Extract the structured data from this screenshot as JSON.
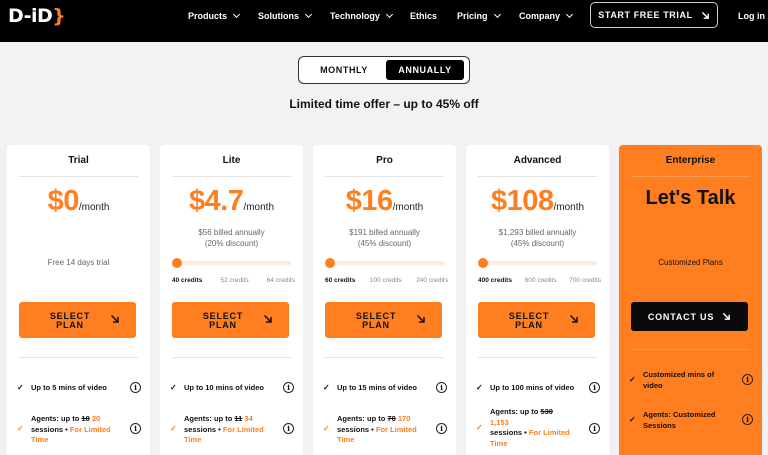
{
  "nav": {
    "logo": "D-iD",
    "items": [
      "Products",
      "Solutions",
      "Technology",
      "Ethics",
      "Pricing",
      "Company"
    ],
    "cta": "START FREE TRIAL",
    "login": "Log in"
  },
  "billing_toggle": {
    "monthly": "MONTHLY",
    "annually": "ANNUALLY",
    "selected": "ANNUALLY"
  },
  "offer": "Limited time offer – up to 45% off",
  "colors": {
    "accent": "#ff7e1f",
    "nav_bg": "#000000",
    "page_bg": "#f2f2f2"
  },
  "plans": {
    "trial": {
      "name": "Trial",
      "price": "$0",
      "period": "/month",
      "note": "Free 14 days trial",
      "button": [
        "SELECT",
        "PLAN"
      ],
      "f1": "Up to 5 mins of video",
      "f2_pre": "Agents: up to ",
      "f2_old": "10",
      "f2_new": " 20",
      "f2_sess": "sessions • ",
      "f2_limited": "For Limited Time"
    },
    "lite": {
      "name": "Lite",
      "price": "$4.7",
      "period": "/month",
      "billed": "$56 billed annually",
      "discount": "(20% discount)",
      "credits": [
        "40 credits",
        "52 credits",
        "64 credits"
      ],
      "button": [
        "SELECT",
        "PLAN"
      ],
      "f1": "Up to 10 mins of video",
      "f2_pre": "Agents: up to ",
      "f2_old": "11",
      "f2_new": " 34",
      "f2_sess": "sessions • ",
      "f2_limited": "For Limited Time"
    },
    "pro": {
      "name": "Pro",
      "price": "$16",
      "period": "/month",
      "billed": "$191 billed annually",
      "discount": "(45% discount)",
      "credits": [
        "60 credits",
        "100 credits",
        "240 credits"
      ],
      "button": [
        "SELECT",
        "PLAN"
      ],
      "f1": "Up to 15 mins of video",
      "f2_pre": "Agents: up to ",
      "f2_old": "70",
      "f2_new": " 170",
      "f2_sess": "sessions • ",
      "f2_limited": "For Limited Time"
    },
    "advanced": {
      "name": "Advanced",
      "price": "$108",
      "period": "/month",
      "billed": "$1,293 billed annually",
      "discount": "(45% discount)",
      "credits": [
        "400 credits",
        "600 credits",
        "700 credits"
      ],
      "button": [
        "SELECT",
        "PLAN"
      ],
      "f1": "Up to 100 mins of video",
      "f2_pre": "Agents: up to ",
      "f2_old": "530",
      "f2_new": "1,153",
      "f2_sess": "sessions • ",
      "f2_limited": "For Limited Time"
    },
    "enterprise": {
      "name": "Enterprise",
      "headline": "Let's Talk",
      "note": "Customized Plans",
      "button": "CONTACT US",
      "f1": "Customized mins of video",
      "f2": "Agents: Customized Sessions"
    }
  }
}
